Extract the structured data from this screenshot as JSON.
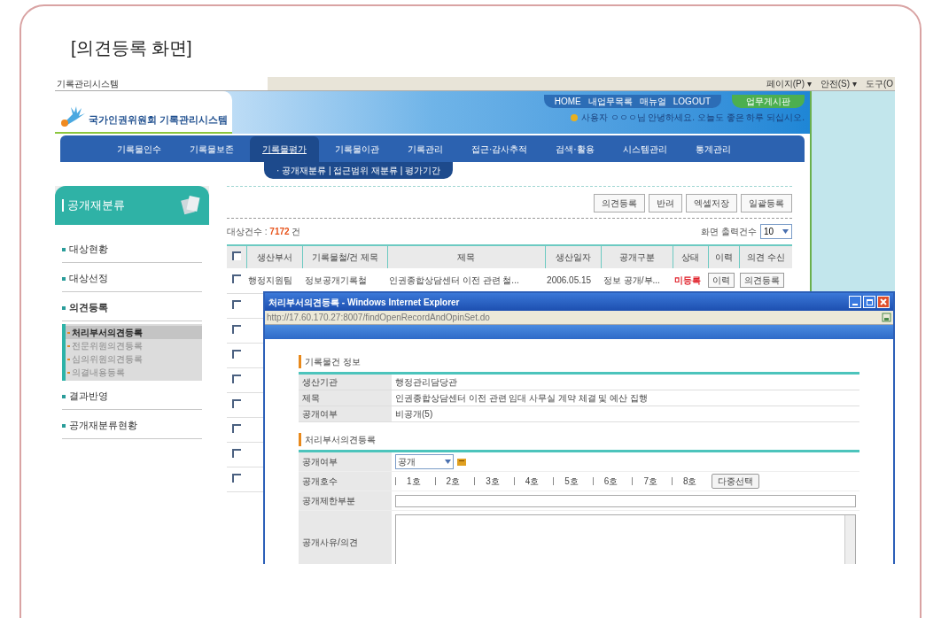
{
  "figure_title": "[의견등록 화면]",
  "browser": {
    "tab": "기록관리시스템",
    "toolbar": [
      "페이지(P) ▾",
      "안전(S) ▾",
      "도구(O"
    ]
  },
  "header": {
    "logo": "국가인권위원회 기록관리시스템",
    "top_links": [
      "HOME",
      "내업무목록",
      "매뉴얼",
      "LOGOUT"
    ],
    "green_link": "업무게시판",
    "welcome": "사용자 ㅇㅇㅇ님 안녕하세요. 오늘도 좋은 하루 되십시오."
  },
  "nav": [
    {
      "label": "기록물인수",
      "selected": false
    },
    {
      "label": "기록물보존",
      "selected": false
    },
    {
      "label": "기록물평가",
      "selected": true
    },
    {
      "label": "기록물이관",
      "selected": false
    },
    {
      "label": "기록관리",
      "selected": false
    },
    {
      "label": "접근·감사추적",
      "selected": false
    },
    {
      "label": "검색·활용",
      "selected": false
    },
    {
      "label": "시스템관리",
      "selected": false
    },
    {
      "label": "통계관리",
      "selected": false
    }
  ],
  "submenu": "· 공개재분류 | 접근범위 재분류 | 평가기간",
  "sidebar": {
    "title": "공개재분류",
    "items": [
      {
        "label": "대상현황",
        "selected": false
      },
      {
        "label": "대상선정",
        "selected": false
      },
      {
        "label": "의견등록",
        "selected": true,
        "children": [
          {
            "label": "처리부서의견등록",
            "selected": true
          },
          {
            "label": "전문위원의견등록",
            "selected": false
          },
          {
            "label": "심의위원의견등록",
            "selected": false
          },
          {
            "label": "의결내용등록",
            "selected": false
          }
        ]
      },
      {
        "label": "결과반영",
        "selected": false
      },
      {
        "label": "공개재분류현황",
        "selected": false
      }
    ]
  },
  "actions": [
    "의견등록",
    "반려",
    "엑셀저장",
    "일괄등록"
  ],
  "count": {
    "label": "대상건수 :",
    "value": "7172",
    "unit": "건"
  },
  "page_size": {
    "label": "화면 출력건수",
    "value": "10"
  },
  "table": {
    "header_checked": false,
    "columns": [
      "생산부서",
      "기록물철/건 제목",
      "제목",
      "생산일자",
      "공개구분",
      "상태",
      "이력",
      "의견 수신"
    ],
    "rows": [
      {
        "checked": false,
        "cells": [
          "행정지원팀",
          "정보공개기록철",
          "인권종합상담센터 이전 관련 철...",
          "2006.05.15",
          "정보 공개/부...",
          "미등록"
        ],
        "buttons": [
          "이력",
          "의견등록"
        ]
      },
      {
        "checked": false
      },
      {
        "checked": false
      },
      {
        "checked": false
      },
      {
        "checked": false
      },
      {
        "checked": false
      },
      {
        "checked": false
      },
      {
        "checked": false
      },
      {
        "checked": false
      }
    ]
  },
  "popup": {
    "title": "처리부서의견등록 - Windows Internet Explorer",
    "url": "http://17.60.170.27:8007/findOpenRecordAndOpinSet.do",
    "info_section": "기록물건 정보",
    "info_rows": [
      {
        "label": "생산기관",
        "value": "행정관리담당관"
      },
      {
        "label": "제목",
        "value": "인권종합상담센터 이전 관련 임대 사무실 계약 체결 및 예산 집행"
      },
      {
        "label": "공개여부",
        "value": "비공개(5)"
      }
    ],
    "form_section": "처리부서의견등록",
    "form": {
      "disclosure_label": "공개여부",
      "disclosure_value": "공개",
      "clause_label": "공개호수",
      "clauses": [
        {
          "label": "1호",
          "checked": false
        },
        {
          "label": "2호",
          "checked": false
        },
        {
          "label": "3호",
          "checked": false
        },
        {
          "label": "4호",
          "checked": false
        },
        {
          "label": "5호",
          "checked": false
        },
        {
          "label": "6호",
          "checked": false
        },
        {
          "label": "7호",
          "checked": false
        },
        {
          "label": "8호",
          "checked": false
        }
      ],
      "clause_button": "다중선택",
      "partial_label": "공개제한부분",
      "reason_label": "공개사유/의견"
    }
  }
}
